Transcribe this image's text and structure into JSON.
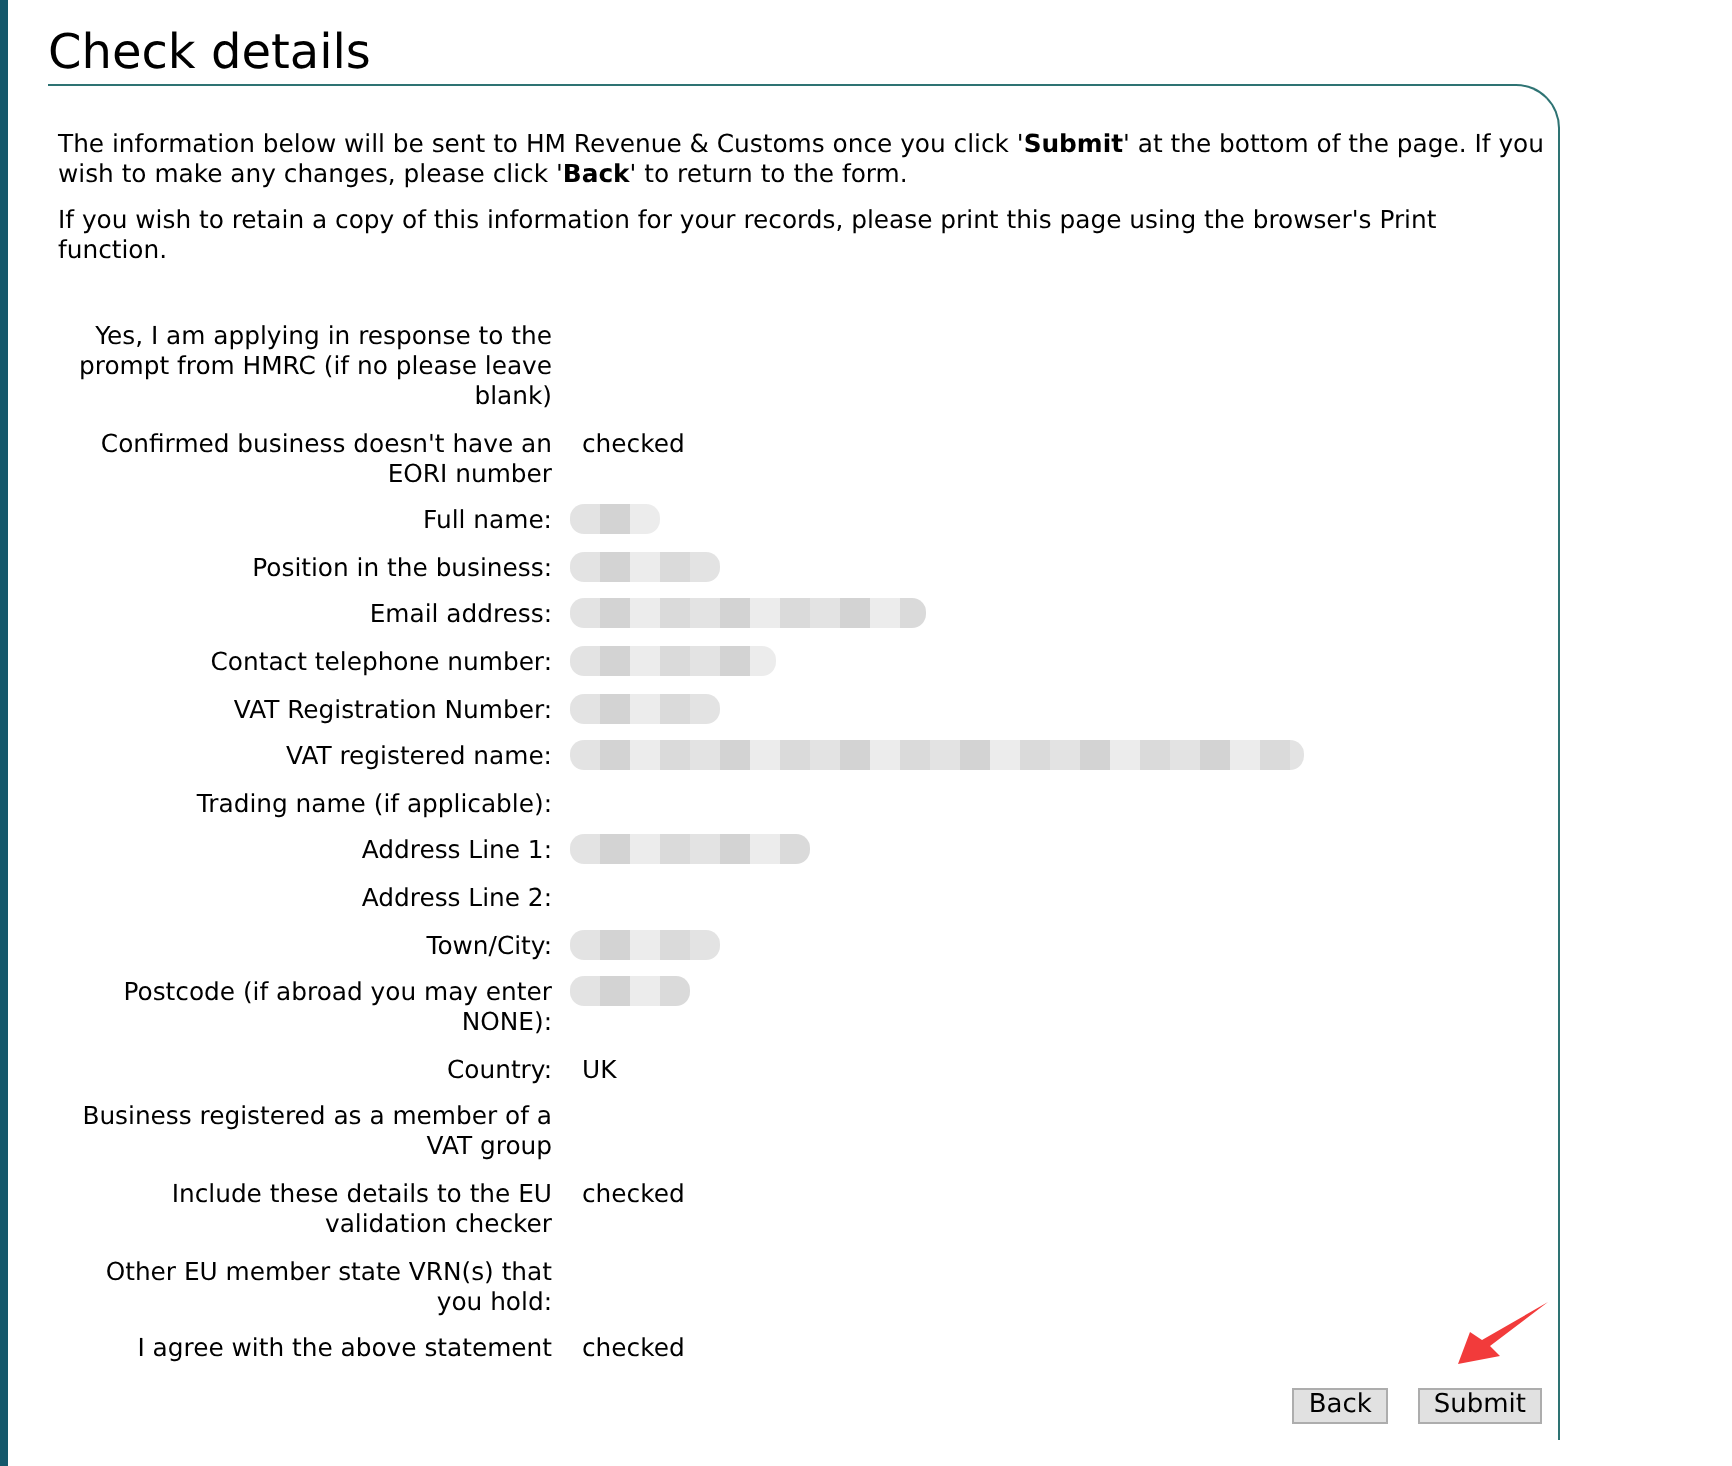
{
  "title": "Check details",
  "intro": [
    "The information below will be sent to HM Revenue & Customs once you click '**Submit**' at the bottom of the page. If you wish to make any changes, please click '**Back**' to return to the form.",
    "If you wish to retain a copy of this information for your records, please print this page using the browser's Print function."
  ],
  "details": [
    {
      "label": "Yes, I am applying in response to the prompt from HMRC (if no please leave blank)",
      "redacted": false
    },
    {
      "label": "Confirmed business doesn't have an EORI number",
      "value": "checked",
      "redacted": false
    },
    {
      "label": "Full name:",
      "redacted": true
    },
    {
      "label": "Position in the business:",
      "redacted": true
    },
    {
      "label": "Email address:",
      "redacted": true
    },
    {
      "label": "Contact telephone number:",
      "redacted": true
    },
    {
      "label": "VAT Registration Number:",
      "redacted": true
    },
    {
      "label": "VAT registered name:",
      "redacted": true
    },
    {
      "label": "Trading name (if applicable):",
      "redacted": false
    },
    {
      "label": "Address Line 1:",
      "redacted": true
    },
    {
      "label": "Address Line 2:",
      "redacted": false
    },
    {
      "label": "Town/City:",
      "redacted": true
    },
    {
      "label": "Postcode (if abroad you may enter NONE):",
      "redacted": true
    },
    {
      "label": "Country:",
      "value": "UK",
      "redacted": false
    },
    {
      "label": "Business registered as a member of a VAT group",
      "redacted": false
    },
    {
      "label": "Include these details to the EU validation checker",
      "value": "checked",
      "redacted": false
    },
    {
      "label": "Other EU member state VRN(s) that you hold:",
      "redacted": false
    },
    {
      "label": "I agree with the above statement",
      "value": "checked",
      "redacted": false
    }
  ],
  "buttons": [
    {
      "label": "Back"
    },
    {
      "label": "Submit"
    }
  ]
}
